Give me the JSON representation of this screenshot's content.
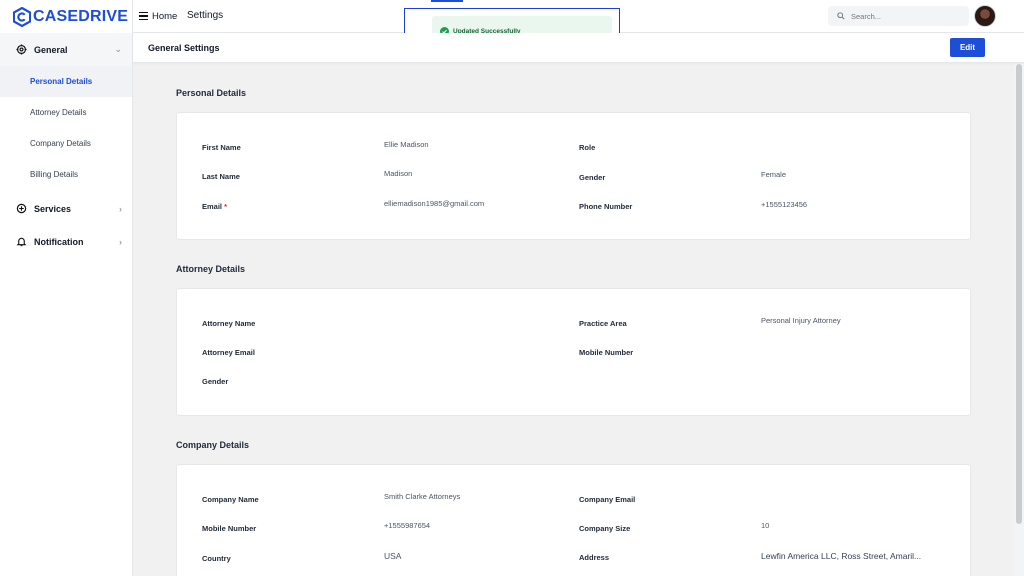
{
  "brand": {
    "name": "CASEDRIVE",
    "color": "#1d4ed8"
  },
  "topbar": {
    "home": "Home",
    "settings": "Settings",
    "search_placeholder": "Search..."
  },
  "toast": {
    "message": "Updated Successfully"
  },
  "subheader": {
    "title": "General Settings",
    "edit_label": "Edit"
  },
  "sidebar": {
    "general": "General",
    "general_items": [
      "Personal Details",
      "Attorney Details",
      "Company Details",
      "Billing Details"
    ],
    "services": "Services",
    "notification": "Notification"
  },
  "personal": {
    "title": "Personal Details",
    "first_name_label": "First Name",
    "first_name": "Ellie Madison",
    "role_label": "Role",
    "last_name_label": "Last Name",
    "last_name": "Madison",
    "gender_label": "Gender",
    "gender": "Female",
    "email_label": "Email",
    "email_required": "*",
    "email": "elliemadison1985@gmail.com",
    "phone_label": "Phone Number",
    "phone": "+1555123456"
  },
  "attorney": {
    "title": "Attorney Details",
    "name_label": "Attorney Name",
    "practice_label": "Practice Area",
    "practice": "Personal Injury Attorney",
    "email_label": "Attorney Email",
    "mobile_label": "Mobile Number",
    "gender_label": "Gender"
  },
  "company": {
    "title": "Company Details",
    "name_label": "Company Name",
    "name": "Smith  Clarke Attorneys",
    "email_label": "Company Email",
    "mobile_label": "Mobile Number",
    "mobile": "+1555987654",
    "size_label": "Company Size",
    "size": "10",
    "country_label": "Country",
    "country": "USA",
    "address_label": "Address",
    "address": "Lewfin America LLC, Ross Street, Amaril..."
  }
}
